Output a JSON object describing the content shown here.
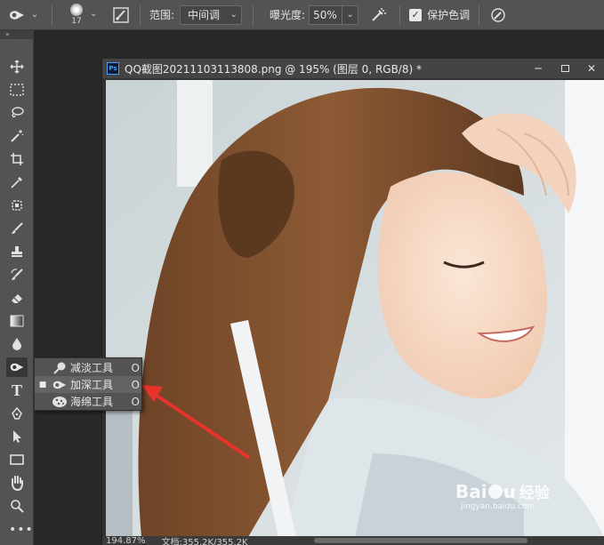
{
  "options_bar": {
    "brush_size": "17",
    "range_label": "范围:",
    "range_value": "中间调",
    "exposure_label": "曝光度:",
    "exposure_value": "50%",
    "protect_tones_label": "保护色调",
    "protect_tones_checked": true
  },
  "document": {
    "app_badge": "Ps",
    "title": "QQ截图20211103113808.png @ 195% (图层 0, RGB/8) *",
    "zoom": "194.87%",
    "doc_info": "文档:355.2K/355.2K"
  },
  "flyout": {
    "items": [
      {
        "icon": "dodge-icon",
        "label": "减淡工具",
        "key": "O",
        "selected": false
      },
      {
        "icon": "burn-icon",
        "label": "加深工具",
        "key": "O",
        "selected": true
      },
      {
        "icon": "sponge-icon",
        "label": "海绵工具",
        "key": "O",
        "selected": false
      }
    ]
  },
  "toolbar": {
    "tools": [
      "move-icon",
      "marquee-icon",
      "lasso-icon",
      "magic-wand-icon",
      "crop-icon",
      "eyedropper-icon",
      "healing-brush-icon",
      "brush-icon",
      "clone-stamp-icon",
      "history-brush-icon",
      "eraser-icon",
      "gradient-icon",
      "blur-icon",
      "burn-icon",
      "type-icon",
      "pen-icon",
      "path-selection-icon",
      "rectangle-icon",
      "hand-icon",
      "zoom-icon"
    ],
    "type_glyph": "T"
  },
  "colors": {
    "accent_arrow": "#e8322c",
    "panel": "#535353",
    "workspace": "#282828"
  },
  "watermark": {
    "brand": "Bai",
    "brand_tail": "u",
    "sub": "经验",
    "url": "jingyan.baidu.com"
  }
}
